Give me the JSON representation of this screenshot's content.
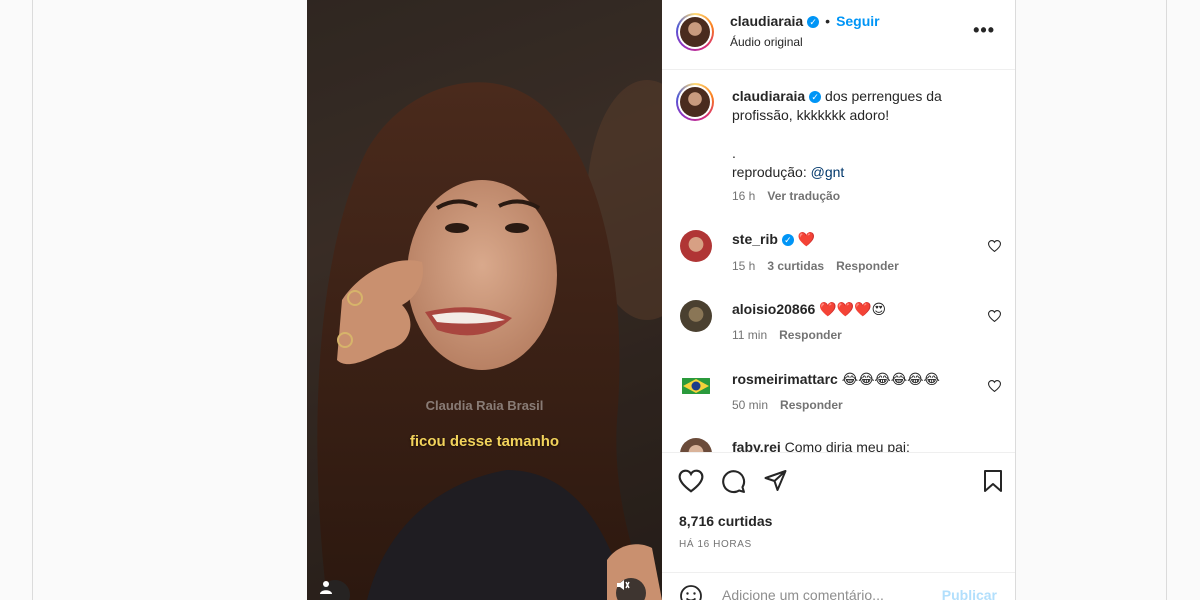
{
  "post": {
    "username": "claudiaraia",
    "follow_label": "Seguir",
    "separator": "•",
    "audio": "Áudio original",
    "more": "•••"
  },
  "video": {
    "watermark": "Claudia Raia Brasil",
    "subtitle": "ficou desse tamanho"
  },
  "caption": {
    "username": "claudiaraia",
    "line1": "dos perrengues da",
    "line2": "profissão, kkkkkkk adoro!",
    "line3": ".",
    "line4_prefix": "reprodução: ",
    "mention": "@gnt",
    "time": "16 h",
    "translate": "Ver tradução"
  },
  "comments": [
    {
      "username": "ste_rib",
      "verified": true,
      "text": "❤️",
      "time": "15 h",
      "likes": "3 curtidas",
      "reply": "Responder"
    },
    {
      "username": "aloisio20866",
      "verified": false,
      "text": "❤️❤️❤️😍",
      "time": "11 min",
      "reply": "Responder"
    },
    {
      "username": "rosmeirimattarc",
      "verified": false,
      "text": "😂😂😂😂😂😂",
      "time": "50 min",
      "reply": "Responder"
    },
    {
      "username": "faby.rei",
      "verified": false,
      "text": "Como diria meu pai:"
    }
  ],
  "stats": {
    "likes": "8,716 curtidas",
    "time": "HÁ 16 HORAS"
  },
  "add_comment": {
    "placeholder": "Adicione um comentário...",
    "post_label": "Publicar"
  },
  "colors": {
    "accent": "#0095f6",
    "subtitle": "#f2d35b",
    "muted": "#737373"
  }
}
